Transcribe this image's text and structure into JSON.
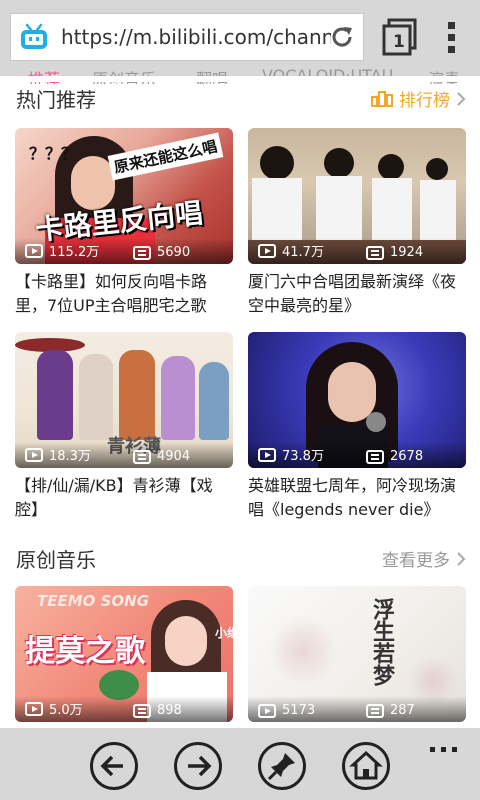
{
  "browser": {
    "url": "https://m.bilibili.com/channe",
    "tab_count": "1",
    "icons": {
      "site": "bilibili-tv-icon",
      "reload": "reload-icon",
      "tabs": "tabs-icon",
      "menu": "vertical-dots-icon",
      "back": "back-arrow-icon",
      "forward": "forward-arrow-icon",
      "pin": "pin-icon",
      "home": "home-icon",
      "more": "horizontal-dots-icon"
    }
  },
  "tab_row": {
    "items": [
      "推荐",
      "原创音乐",
      "翻唱",
      "VOCALOID·UTAU",
      "演奏"
    ]
  },
  "hot": {
    "title": "热门推荐",
    "ranking_label": "排行榜",
    "videos": [
      {
        "plays": "115.2万",
        "danmaku": "5690",
        "title": "【卡路里】如何反向唱卡路里，7位UP主合唱肥宅之歌",
        "cover_text": "卡路里反向唱",
        "cover_sub": "原来还能这么唱",
        "cover_q": "？？？"
      },
      {
        "plays": "41.7万",
        "danmaku": "1924",
        "title": "厦门六中合唱团最新演绎《夜空中最亮的星》"
      },
      {
        "plays": "18.3万",
        "danmaku": "4904",
        "title": "【排/仙/漏/KB】青衫薄【戏腔】",
        "cover_text": "青衫薄"
      },
      {
        "plays": "73.8万",
        "danmaku": "2678",
        "title": "英雄联盟七周年，阿冷现场演唱《legends never die》"
      }
    ]
  },
  "original": {
    "title": "原创音乐",
    "more_label": "查看更多",
    "videos": [
      {
        "plays": "5.0万",
        "danmaku": "898",
        "cover_text": "提莫之歌",
        "cover_sub": "TEEMO SONG",
        "cover_name": "小缘"
      },
      {
        "plays": "5173",
        "danmaku": "287",
        "cover_text": "浮生若梦"
      }
    ]
  },
  "colors": {
    "accent_orange": "#f5a623",
    "browser_bar": "#d7d7d7",
    "bilibili_blue": "#23ade5"
  }
}
